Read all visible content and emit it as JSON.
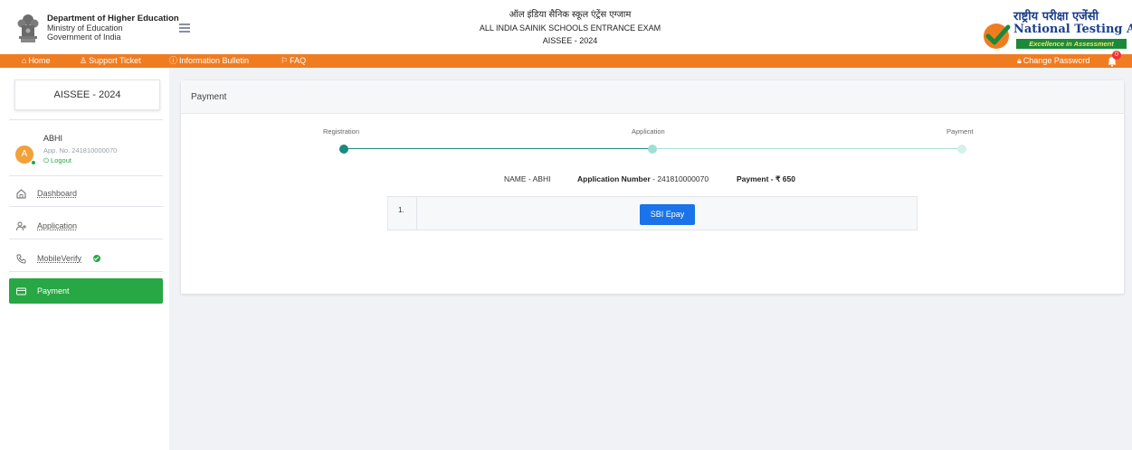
{
  "header": {
    "dept_line1": "Department of Higher Education",
    "dept_line2": "Ministry of Education",
    "dept_line3": "Government of India",
    "title_hindi": "ऑल इंडिया सैनिक स्कूल एंट्रेंस एग्जाम",
    "title_english": "ALL INDIA SAINIK SCHOOLS ENTRANCE EXAM",
    "exam_code": "AISSEE - 2024",
    "nta_hindi": "राष्ट्रीय परीक्षा एजेंसी",
    "nta_english": "National Testing Agency",
    "nta_tagline": "Excellence in Assessment"
  },
  "nav": {
    "home": "Home",
    "support": "Support Ticket",
    "bulletin": "Information Bulletin",
    "faq": "FAQ",
    "change_password": "Change Password",
    "notification_count": "0"
  },
  "sidebar": {
    "exam_box": "AISSEE - 2024",
    "user": {
      "initial": "A",
      "name": "ABHI",
      "app_no": "App. No. 241810000070",
      "logout": "Logout"
    },
    "items": [
      {
        "label": "Dashboard"
      },
      {
        "label": "Application"
      },
      {
        "label": "MobileVerify"
      },
      {
        "label": "Payment"
      }
    ]
  },
  "main": {
    "title": "Payment",
    "steps": [
      "Registration",
      "Application",
      "Payment"
    ],
    "info": {
      "name": "NAME - ABHI",
      "app_label": "Application Number",
      "app_value": " - 241810000070",
      "pay_label": "Payment - ₹ 650"
    },
    "table": {
      "row_no": "1.",
      "button": "SBI Epay"
    }
  },
  "colors": {
    "accent_orange": "#f07c21",
    "active_green": "#28a745",
    "step_teal": "#1a8a7a",
    "button_blue": "#1a73e8"
  }
}
